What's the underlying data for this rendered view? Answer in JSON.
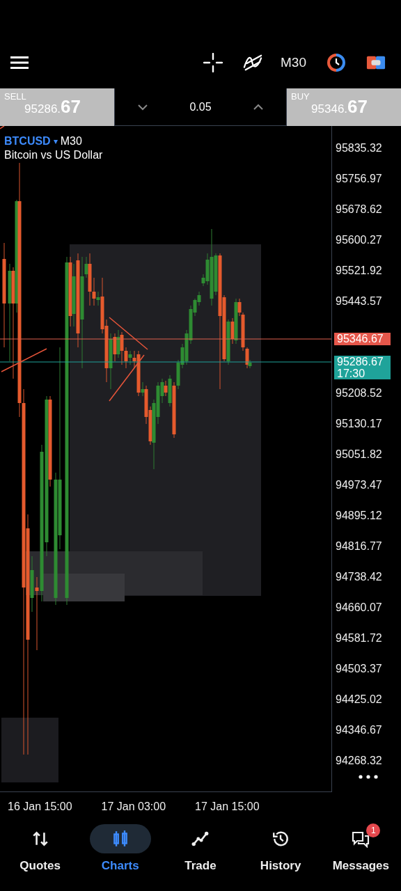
{
  "toolbar": {
    "timeframe": "M30"
  },
  "trade_bar": {
    "sell": {
      "label": "SELL",
      "price_main": "95286.",
      "price_big": "67"
    },
    "volume": "0.05",
    "buy": {
      "label": "BUY",
      "price_main": "95346.",
      "price_big": "67"
    }
  },
  "chart": {
    "symbol": "BTCUSD",
    "caret": "▾",
    "timeframe": "M30",
    "description": "Bitcoin vs US Dollar",
    "price_labels_upper": [
      "95835.32",
      "95756.97",
      "95678.62",
      "95600.27",
      "95521.92",
      "95443.57"
    ],
    "ask_tag": "95346.67",
    "bid_tag": {
      "price": "95286.67",
      "time": "17:30"
    },
    "price_labels_lower": [
      "95208.52",
      "95130.17",
      "95051.82",
      "94973.47",
      "94895.12",
      "94816.77",
      "94738.42",
      "94660.07",
      "94581.72",
      "94503.37",
      "94425.02",
      "94346.67",
      "94268.32"
    ],
    "time_labels": [
      "16 Jan 15:00",
      "17 Jan 03:00",
      "17 Jan 15:00"
    ]
  },
  "nav": [
    {
      "label": "Quotes",
      "selected": false,
      "kind": "quotes"
    },
    {
      "label": "Charts",
      "selected": true,
      "kind": "charts"
    },
    {
      "label": "Trade",
      "selected": false,
      "kind": "trade"
    },
    {
      "label": "History",
      "selected": false,
      "kind": "history"
    },
    {
      "label": "Messages",
      "selected": false,
      "kind": "messages",
      "badge": "1"
    }
  ]
}
